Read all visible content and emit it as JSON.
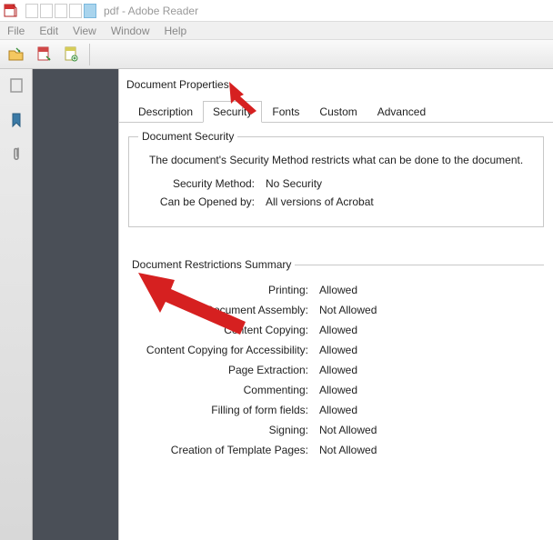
{
  "titlebar": {
    "text": "pdf - Adobe Reader"
  },
  "menu": {
    "items": [
      "File",
      "Edit",
      "View",
      "Window",
      "Help"
    ]
  },
  "dialog": {
    "title": "Document Properties",
    "tabs": [
      "Description",
      "Security",
      "Fonts",
      "Custom",
      "Advanced"
    ],
    "active_tab": "Security",
    "doc_security": {
      "legend": "Document Security",
      "intro": "The document's Security Method restricts what can be done to the document.",
      "method_label": "Security Method:",
      "method_value": "No Security",
      "opened_label": "Can be Opened by:",
      "opened_value": "All versions of Acrobat"
    },
    "restrictions": {
      "legend": "Document Restrictions Summary",
      "rows": [
        {
          "label": "Printing:",
          "value": "Allowed"
        },
        {
          "label": "Document Assembly:",
          "value": "Not Allowed"
        },
        {
          "label": "Content Copying:",
          "value": "Allowed"
        },
        {
          "label": "Content Copying for Accessibility:",
          "value": "Allowed"
        },
        {
          "label": "Page Extraction:",
          "value": "Allowed"
        },
        {
          "label": "Commenting:",
          "value": "Allowed"
        },
        {
          "label": "Filling of form fields:",
          "value": "Allowed"
        },
        {
          "label": "Signing:",
          "value": "Not Allowed"
        },
        {
          "label": "Creation of Template Pages:",
          "value": "Not Allowed"
        }
      ]
    }
  }
}
